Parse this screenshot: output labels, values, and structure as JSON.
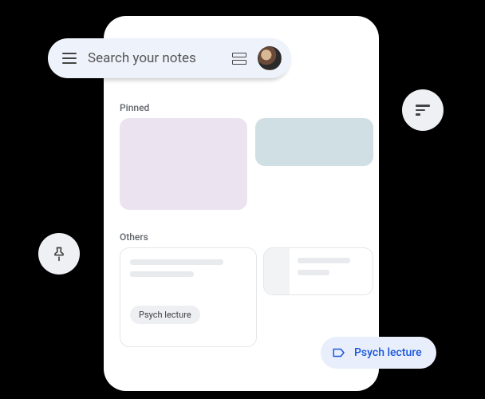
{
  "search": {
    "placeholder": "Search your notes"
  },
  "sections": {
    "pinned": "Pinned",
    "others": "Others"
  },
  "note_chip": "Psych lecture",
  "label_pill": "Psych lecture"
}
